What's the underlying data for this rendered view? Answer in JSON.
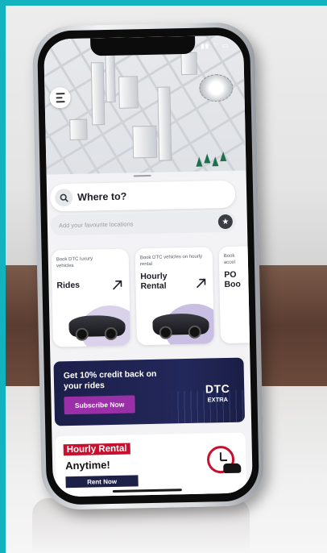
{
  "status_bar": {
    "icons_text": "▮▮ ⌔ ▭"
  },
  "map": {
    "menu_icon": "hamburger-icon"
  },
  "search": {
    "label": "Where to?",
    "favourites_hint": "Add your favourite locations"
  },
  "services": [
    {
      "sub": "Book DTC luxury vehicles",
      "title": "Rides"
    },
    {
      "sub": "Book DTC vehicles on hourly rental",
      "title": "Hourly Rental"
    },
    {
      "sub": "Book accel",
      "title": "PO Boo"
    }
  ],
  "promo": {
    "title": "Get 10% credit back on your rides",
    "button": "Subscribe Now",
    "brand_line1": "DTC",
    "brand_line2": "EXTRA"
  },
  "rental_banner": {
    "tag": "Hourly Rental",
    "title": "Anytime!",
    "button": "Rent Now"
  },
  "colors": {
    "accent_teal": "#12b3bf",
    "promo_bg": "#1c1f4a",
    "subscribe_btn": "#9b2fa8",
    "rental_red": "#c8102e"
  }
}
